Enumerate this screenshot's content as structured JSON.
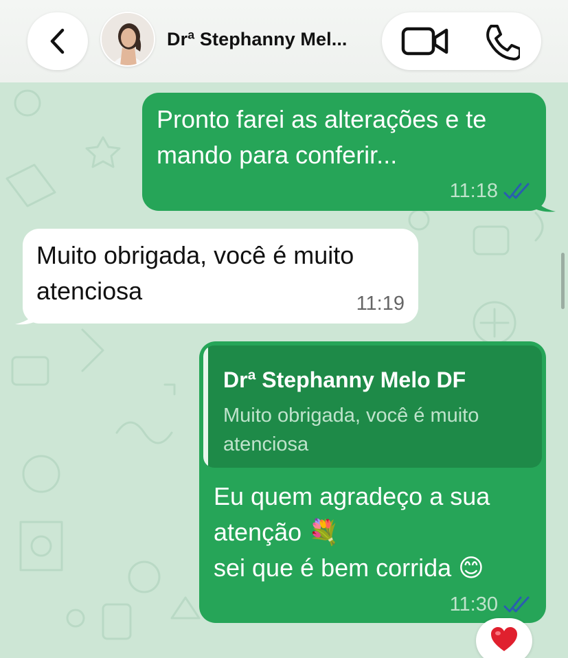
{
  "header": {
    "contact_name": "Drª Stephanny Mel...",
    "icons": {
      "back": "chevron-left-icon",
      "video": "video-camera-icon",
      "voice": "phone-icon"
    }
  },
  "messages": [
    {
      "direction": "outgoing",
      "text_lines": [
        "Pronto farei as alterações e te",
        "mando para conferir..."
      ],
      "time": "11:18",
      "status": "read"
    },
    {
      "direction": "incoming",
      "text_lines": [
        "Muito obrigada, você é muito",
        "atenciosa"
      ],
      "time": "11:19"
    },
    {
      "direction": "outgoing",
      "quote": {
        "author": "Drª Stephanny Melo DF",
        "text_lines": [
          "Muito obrigada, você é muito",
          "atenciosa"
        ]
      },
      "text_lines": [
        "Eu quem agradeço a sua",
        "atenção 💐",
        "sei que é bem corrida 😊"
      ],
      "time": "11:30",
      "status": "read",
      "reaction": "❤️"
    }
  ],
  "colors": {
    "outgoing_bubble": "#26a558",
    "incoming_bubble": "#ffffff",
    "wallpaper": "#cde6d5",
    "read_ticks": "#2a5db0"
  }
}
